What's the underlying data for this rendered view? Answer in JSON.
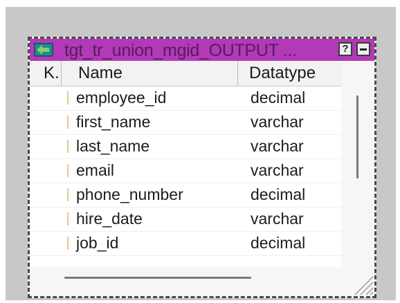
{
  "window": {
    "title": "tgt_tr_union_mgid_OUTPUT ...",
    "help_button": "?",
    "minimize_button": "-"
  },
  "columns": {
    "key": "K.",
    "name": "Name",
    "datatype": "Datatype"
  },
  "rows": [
    {
      "name": "employee_id",
      "datatype": "decimal"
    },
    {
      "name": "first_name",
      "datatype": "varchar"
    },
    {
      "name": "last_name",
      "datatype": "varchar"
    },
    {
      "name": "email",
      "datatype": "varchar"
    },
    {
      "name": "phone_number",
      "datatype": "decimal"
    },
    {
      "name": "hire_date",
      "datatype": "varchar"
    },
    {
      "name": "job_id",
      "datatype": "decimal"
    }
  ],
  "colors": {
    "title_bar": "#b23ab8",
    "title_text": "#5a1a5e",
    "key_marker": "#e9c88f",
    "canvas": "#c8c8c8"
  },
  "icons": {
    "title": "target-definition-icon",
    "resize": "resize-grip-icon"
  }
}
